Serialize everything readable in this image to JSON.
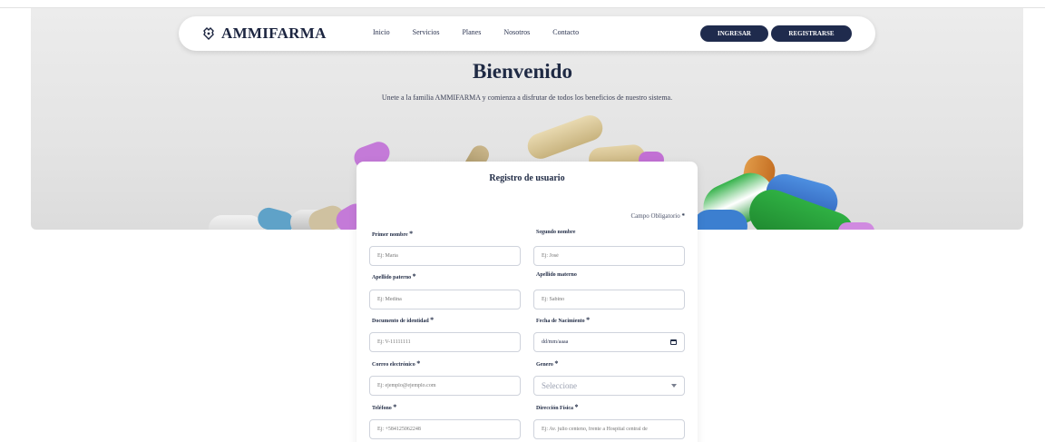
{
  "brand": {
    "name": "AMMIFARMA",
    "icon": "pharmacy-logo-icon"
  },
  "nav": {
    "links": [
      "Inicio",
      "Servicios",
      "Planes",
      "Nosotros",
      "Contacto"
    ],
    "login_label": "INGRESAR",
    "register_label": "REGISTRARSE"
  },
  "hero": {
    "title": "Bienvenido",
    "subtitle": "Unete a la familia AMMIFARMA y comienza a disfrutar de todos los beneficios de nuestro sistema."
  },
  "form": {
    "title": "Registro de usuario",
    "required_note": "Campo Obligatorio",
    "required_mark": "*",
    "fields": {
      "first_name": {
        "label": "Primer nombre",
        "placeholder": "Ej: María",
        "required": true
      },
      "middle_name": {
        "label": "Segundo nombre",
        "placeholder": "Ej: José",
        "required": false
      },
      "last_name": {
        "label": "Apellido paterno",
        "placeholder": "Ej: Medina",
        "required": true
      },
      "mother_last_name": {
        "label": "Apellido materno",
        "placeholder": "Ej: Sabino",
        "required": false
      },
      "id_document": {
        "label": "Documento de identidad",
        "placeholder": "Ej: V-11111111",
        "required": true
      },
      "birth_date": {
        "label": "Fecha de Nacimiento",
        "value": "dd/mm/aaaa",
        "required": true
      },
      "email": {
        "label": "Correo electrónico",
        "placeholder": "Ej: ejemplo@ejemplo.com",
        "required": true
      },
      "gender": {
        "label": "Genero",
        "value": "Seleccione",
        "required": true
      },
      "phone": {
        "label": "Teléfono",
        "placeholder": "Ej: +584125062248",
        "required": true
      },
      "address": {
        "label": "Dirección Física",
        "placeholder": "Ej: Av. julio centeno, frente a Hospital central de",
        "required": true
      }
    }
  },
  "colors": {
    "primary": "#1f2b4d",
    "hero_bg": "#e6e6e6"
  }
}
